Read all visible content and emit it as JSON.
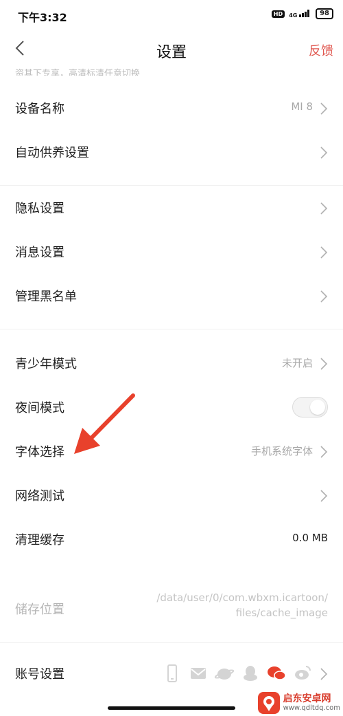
{
  "status_bar": {
    "time": "下午3:32",
    "hd": "HD",
    "network": "4G",
    "battery": "98"
  },
  "nav": {
    "title": "设置",
    "feedback": "反馈"
  },
  "cut_text": "资其下专享，高清标清任意切换",
  "settings": {
    "device_name": {
      "label": "设备名称",
      "value": "MI 8"
    },
    "auto_care": {
      "label": "自动供养设置"
    },
    "privacy": {
      "label": "隐私设置"
    },
    "messages": {
      "label": "消息设置"
    },
    "blacklist": {
      "label": "管理黑名单"
    },
    "youth_mode": {
      "label": "青少年模式",
      "value": "未开启"
    },
    "night_mode": {
      "label": "夜间模式",
      "enabled": false
    },
    "font": {
      "label": "字体选择",
      "value": "手机系统字体"
    },
    "network_test": {
      "label": "网络测试"
    },
    "clear_cache": {
      "label": "清理缓存",
      "value": "0.0 MB"
    },
    "storage": {
      "label": "储存位置",
      "path_line1": "/data/user/0/com.wbxm.icartoon/",
      "path_line2": "files/cache_image"
    },
    "account": {
      "label": "账号设置",
      "icons": [
        "phone-icon",
        "mail-icon",
        "weibo-icon",
        "qq-icon",
        "wechat-icon",
        "weibo-alt-icon"
      ]
    }
  },
  "annotation": {
    "color": "#e8412c"
  },
  "watermark": {
    "name": "启东安卓网",
    "url": "www.qdltdq.com"
  }
}
